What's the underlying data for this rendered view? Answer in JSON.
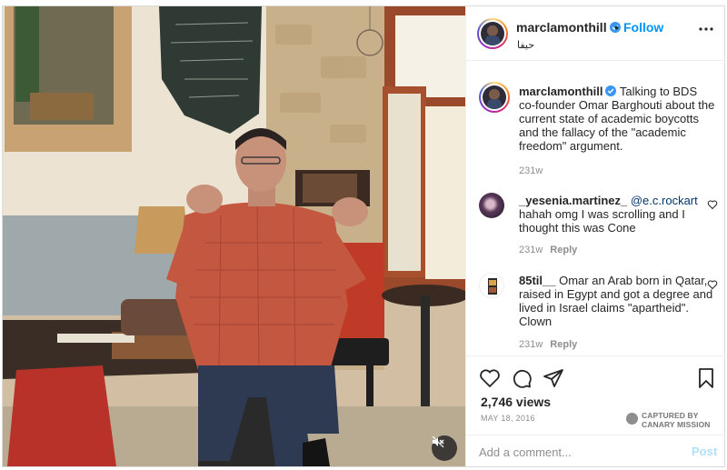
{
  "post": {
    "username": "marclamonthill",
    "verified": true,
    "dot": "•",
    "follow_label": "Follow",
    "location": "حيفا",
    "caption": "Talking to BDS co-founder Omar Barghouti about the current state of academic boycotts and the fallacy of the \"academic freedom\" argument.",
    "caption_age": "231w"
  },
  "comments": [
    {
      "username": "_yesenia.martinez_",
      "mention": "@e.c.rockart",
      "text": "hahah omg I was scrolling and I thought this was Cone",
      "age": "231w",
      "reply_label": "Reply"
    },
    {
      "username": "85til__",
      "text": "Omar an Arab born in Qatar, raised in Egypt and got a degree and lived in Israel claims \"apartheid\". Clown",
      "age": "231w",
      "reply_label": "Reply"
    }
  ],
  "footer": {
    "views": "2,746 views",
    "date": "MAY 18, 2016",
    "captured_line1": "CAPTURED BY",
    "captured_line2": "CANARY MISSION",
    "comment_placeholder": "Add a comment...",
    "post_label": "Post"
  },
  "icons": {
    "verified": "verified-badge-icon",
    "more": "more-options-icon",
    "heart": "heart-icon",
    "comment": "comment-bubble-icon",
    "share": "paper-plane-icon",
    "save": "bookmark-icon",
    "mute": "speaker-muted-icon",
    "watermark": "canary-mission-icon"
  },
  "colors": {
    "accent": "#0095f6",
    "verified": "#3897f0",
    "muted_text": "#8e8e8e",
    "post_disabled": "#b2dffc"
  }
}
